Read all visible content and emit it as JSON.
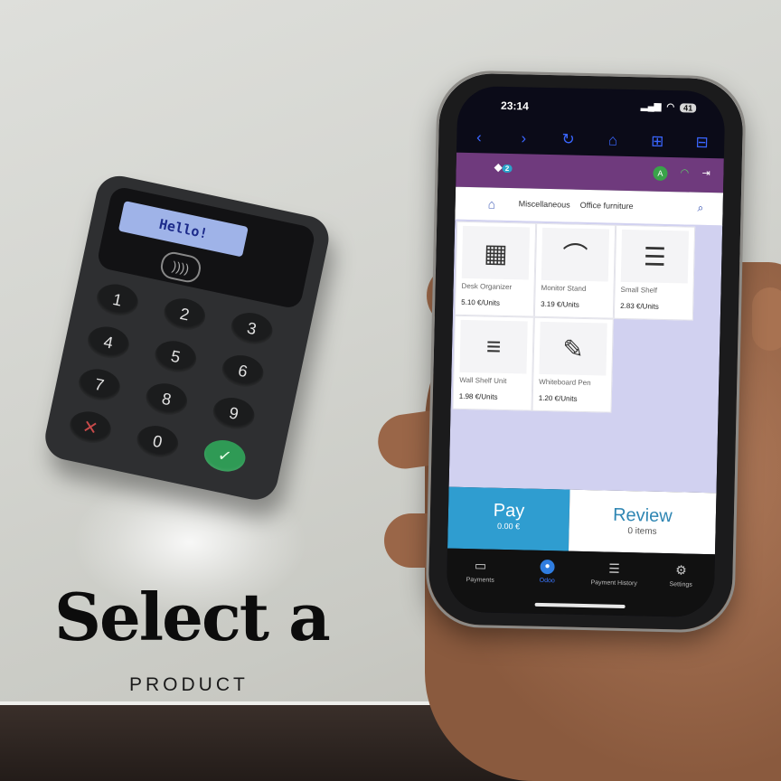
{
  "terminal": {
    "display_text": "Hello!",
    "nfc_symbol": "))))",
    "keys": [
      "1",
      "2",
      "3",
      "4",
      "5",
      "6",
      "7",
      "8",
      "9",
      "✕",
      "0",
      "✓"
    ]
  },
  "caption": {
    "title": "Select a",
    "subtitle": "PRODUCT"
  },
  "phone": {
    "status": {
      "time": "23:14",
      "battery": "41"
    },
    "app_badge_count": "2",
    "avatar_letter": "A",
    "breadcrumb": [
      "Miscellaneous",
      "Office furniture"
    ],
    "products": [
      {
        "name": "Desk Organizer",
        "price": "5.10 €/Units",
        "icon": "desk-organizer-icon"
      },
      {
        "name": "Monitor Stand",
        "price": "3.19 €/Units",
        "icon": "monitor-stand-icon"
      },
      {
        "name": "Small Shelf",
        "price": "2.83 €/Units",
        "icon": "shelf-icon"
      },
      {
        "name": "Wall Shelf Unit",
        "price": "1.98 €/Units",
        "icon": "wall-shelf-icon"
      },
      {
        "name": "Whiteboard Pen",
        "price": "1.20 €/Units",
        "icon": "pen-icon"
      }
    ],
    "pay": {
      "label": "Pay",
      "amount": "0.00 €"
    },
    "review": {
      "label": "Review",
      "count": "0 items"
    },
    "tabs": [
      "Payments",
      "Odoo",
      "Payment History",
      "Settings"
    ]
  },
  "colors": {
    "app_bar": "#6f3a7d",
    "pay_button": "#2f9dd0",
    "review_text": "#2f86b3",
    "ok_key": "#2f9a55"
  }
}
